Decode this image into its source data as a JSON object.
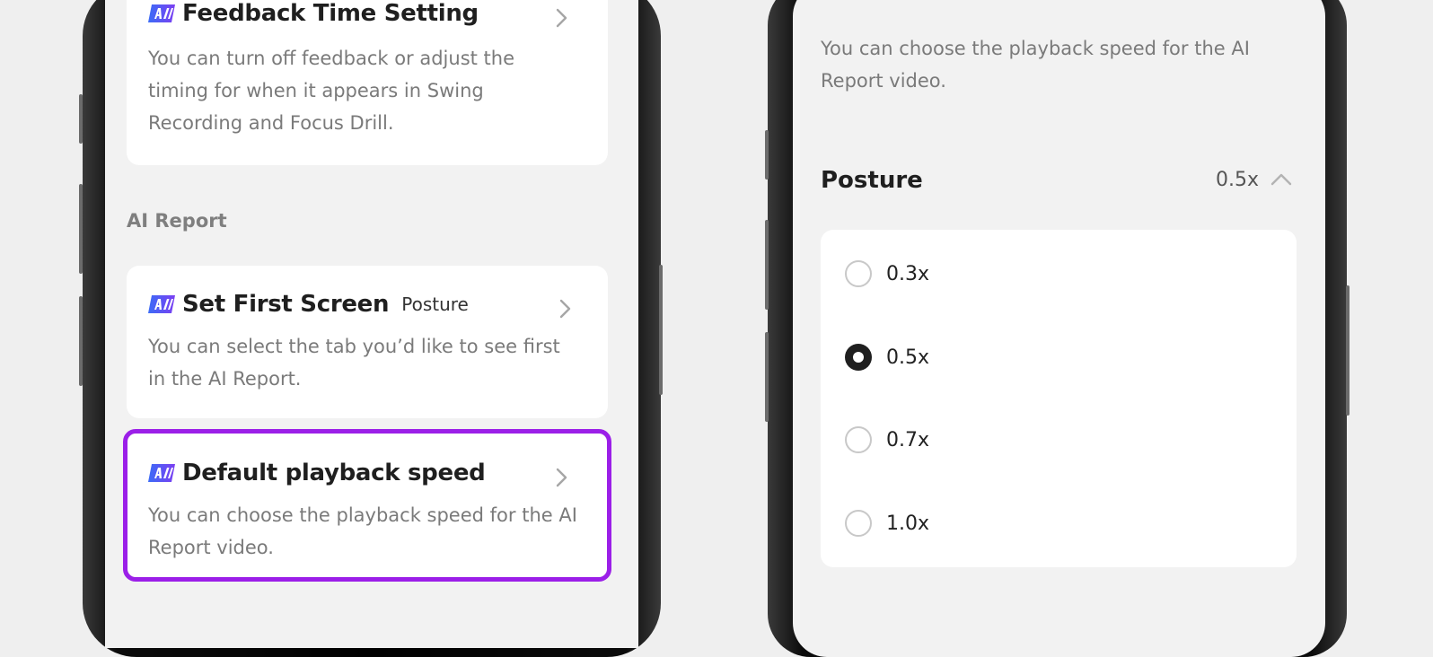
{
  "left_screen": {
    "feedback_card": {
      "title": "Feedback Time Setting",
      "description": "You can turn off feedback or adjust the timing for when it appears in Swing Recording and Focus Drill."
    },
    "section_label": "AI Report",
    "first_screen_card": {
      "title": "Set First Screen",
      "tag": "Posture",
      "description": "You can select the tab you’d like to see first in the AI Report."
    },
    "playback_card": {
      "title": "Default playback speed",
      "description": "You can choose the playback speed for the AI Report video."
    },
    "highlight_color": "#9b1fe8",
    "badge_icon": "ai-badge-icon"
  },
  "right_screen": {
    "description": "You can choose the playback speed for the AI Report video.",
    "posture_section": {
      "label": "Posture",
      "current_value": "0.5x",
      "expanded": true
    },
    "speed_options": [
      {
        "label": "0.3x",
        "selected": false
      },
      {
        "label": "0.5x",
        "selected": true
      },
      {
        "label": "0.7x",
        "selected": false
      },
      {
        "label": "1.0x",
        "selected": false
      }
    ]
  },
  "colors": {
    "background": "#efefef",
    "card": "#ffffff",
    "accent_purple": "#9b1fe8",
    "selected_radio": "#1f1f1f",
    "muted_text": "#7a7a7a"
  }
}
